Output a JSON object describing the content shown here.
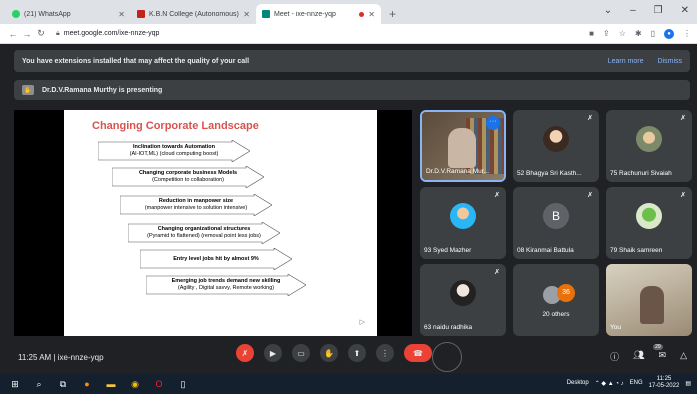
{
  "browser": {
    "tabs": [
      {
        "title": "(21) WhatsApp",
        "fav_color": "#25d366"
      },
      {
        "title": "K.B.N College (Autonomous) Mai",
        "fav_color": "#c5221f"
      },
      {
        "title": "Meet - ixe-nnze-yqp",
        "fav_color": "#00897b"
      }
    ],
    "new_tab": "+",
    "url": "meet.google.com/ixe-nnze-yqp"
  },
  "banner": {
    "message": "You have extensions installed that may affect the quality of your call",
    "learn_more": "Learn more",
    "dismiss": "Dismiss"
  },
  "presenting": "Dr.D.V.Ramana Murthy is presenting",
  "slide": {
    "title": "Changing  Corporate Landscape",
    "items": [
      {
        "bold": "Inclination towards Automation",
        "sub": "(AI-IOT,ML) (cloud computing boost)"
      },
      {
        "bold": "Changing corporate business Models",
        "sub": "(Competition to collaboration)"
      },
      {
        "bold": "Reduction in  manpower size",
        "sub": "(manpower intensive to solution intensive)"
      },
      {
        "bold": "Changing organizational structures",
        "sub": "(Pyramid to flattened) (removal point less jobs)"
      },
      {
        "bold": "Entry level jobs hit by almost 9%",
        "sub": ""
      },
      {
        "bold": "Emerging job trends demand new skilling",
        "sub": "(Agility , Digital savvy, Remote working)"
      }
    ]
  },
  "participants": [
    {
      "name": "Dr.D.V.Ramana Mur..."
    },
    {
      "name": "52 Bhagya Sri Kasth..."
    },
    {
      "name": "75 Rachunuri Sivaiah"
    },
    {
      "name": "93 Syed Mazher"
    },
    {
      "name": "08 Kiranmai Battula",
      "initial": "B"
    },
    {
      "name": "79 Shaik samreen"
    },
    {
      "name": "63 naidu radhika"
    },
    {
      "name": "20 others",
      "count": "36"
    },
    {
      "name": "You"
    }
  ],
  "meeting": {
    "time": "11:25 AM",
    "separator": "|",
    "code": "ixe-nnze-yqp",
    "people_count": "29"
  },
  "taskbar": {
    "desktop": "Desktop",
    "lang": "ENG",
    "time": "11:25",
    "date": "17-05-2022"
  }
}
